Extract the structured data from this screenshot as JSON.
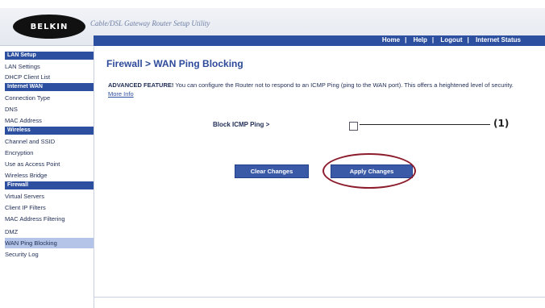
{
  "header": {
    "logo": "BELKIN",
    "app_title": "Cable/DSL Gateway Router Setup Utility",
    "links": [
      "Home",
      "Help",
      "Logout",
      "Internet Status"
    ]
  },
  "sidebar": {
    "sections": [
      {
        "title": "LAN Setup",
        "items": [
          "LAN Settings",
          "DHCP Client List"
        ]
      },
      {
        "title": "Internet WAN",
        "items": [
          "Connection Type",
          "DNS",
          "MAC Address"
        ]
      },
      {
        "title": "Wireless",
        "items": [
          "Channel and SSID",
          "Encryption",
          "Use as Access Point",
          "Wireless Bridge"
        ]
      },
      {
        "title": "Firewall",
        "items": [
          "Virtual Servers",
          "Client IP Filters",
          "MAC Address Filtering",
          "DMZ",
          "WAN Ping Blocking",
          "Security Log"
        ]
      }
    ],
    "active_item": "WAN Ping Blocking"
  },
  "main": {
    "title": "Firewall > WAN Ping Blocking",
    "desc_bold": "ADVANCED FEATURE!",
    "desc_text": " You can configure the Router not to respond to an ICMP Ping (ping to the WAN port). This offers a heightened level of security. ",
    "desc_more": "More Info",
    "block_label": "Block ICMP Ping >",
    "clear_button": "Clear Changes",
    "apply_button": "Apply Changes",
    "callout": "(1)"
  },
  "colors": {
    "accent": "#2c4fa0",
    "highlight": "#8c1c2c"
  }
}
